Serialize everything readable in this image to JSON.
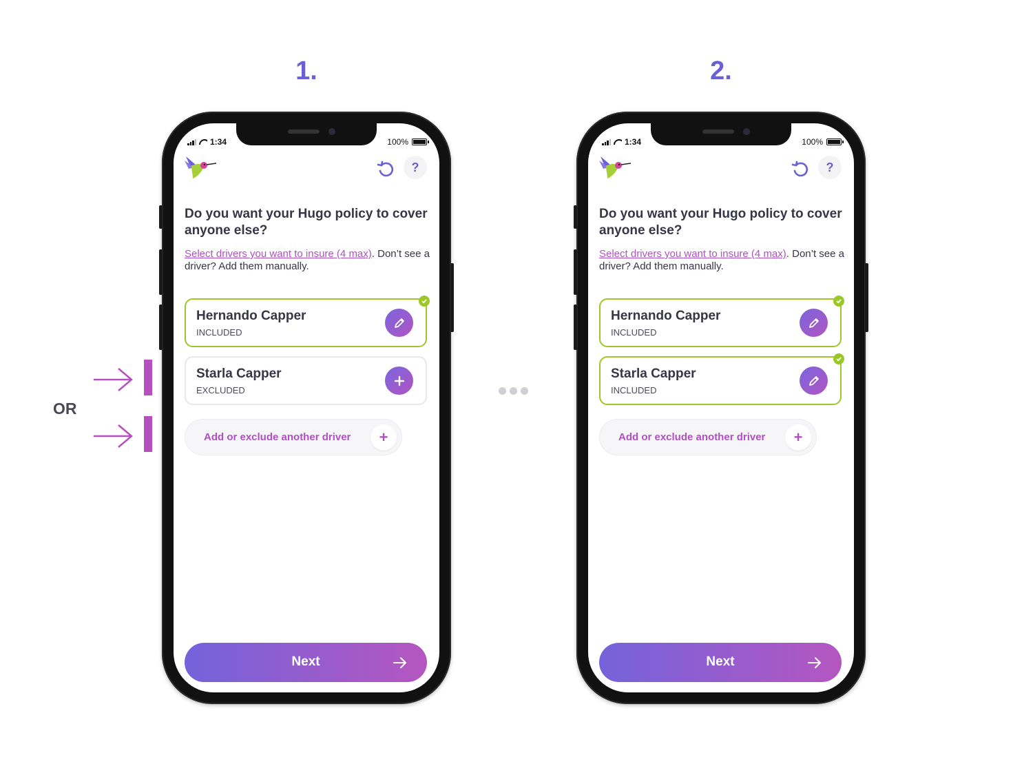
{
  "steps": [
    {
      "number": "1."
    },
    {
      "number": "2."
    }
  ],
  "annotation": {
    "or_label": "OR"
  },
  "screens": [
    {
      "status_time": "1:34",
      "status_battery": "100%",
      "question": "Do you want your Hugo policy to cover anyone else?",
      "helper_link": "Select drivers you want to insure (4 max)",
      "helper_rest": ". Don’t see a driver? Add them manually.",
      "help_label": "?",
      "drivers": [
        {
          "name": "Hernando Capper",
          "status": "INCLUDED",
          "action_icon": "pencil-icon",
          "selected": true
        },
        {
          "name": "Starla Capper",
          "status": "EXCLUDED",
          "action_icon": "plus-icon",
          "selected": false
        }
      ],
      "add_driver_label": "Add or exclude another driver",
      "add_plus": "+",
      "next_label": "Next"
    },
    {
      "status_time": "1:34",
      "status_battery": "100%",
      "question": "Do you want your Hugo policy to cover anyone else?",
      "helper_link": "Select drivers you want to insure (4 max)",
      "helper_rest": ". Don’t see a driver? Add them manually.",
      "help_label": "?",
      "drivers": [
        {
          "name": "Hernando Capper",
          "status": "INCLUDED",
          "action_icon": "pencil-icon",
          "selected": true
        },
        {
          "name": "Starla Capper",
          "status": "INCLUDED",
          "action_icon": "pencil-icon",
          "selected": true
        }
      ],
      "add_driver_label": "Add or exclude another driver",
      "add_plus": "+",
      "next_label": "Next"
    }
  ],
  "colors": {
    "accent_purple": "#6b5fd6",
    "accent_magenta": "#b04fc3",
    "selected_green": "#9cc728"
  }
}
